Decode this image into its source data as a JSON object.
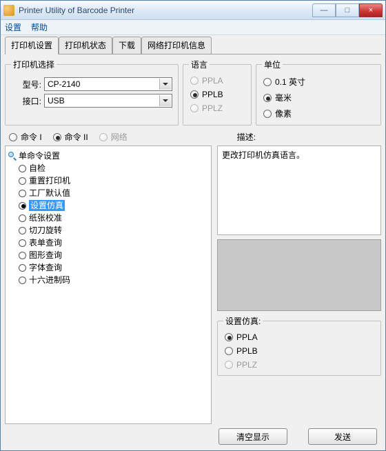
{
  "window": {
    "title": "Printer Utility of Barcode Printer"
  },
  "winbuttons": {
    "min": "—",
    "max": "□",
    "close": "×"
  },
  "menu": {
    "settings": "设置",
    "help": "帮助"
  },
  "tabs": [
    {
      "label": "打印机设置",
      "active": true
    },
    {
      "label": "打印机状态",
      "active": false
    },
    {
      "label": "下载",
      "active": false
    },
    {
      "label": "网络打印机信息",
      "active": false
    }
  ],
  "printer_select": {
    "legend": "打印机选择",
    "model_label": "型号:",
    "model_value": "CP-2140",
    "port_label": "接口:",
    "port_value": "USB"
  },
  "language": {
    "legend": "语言",
    "options": [
      {
        "label": "PPLA",
        "checked": false,
        "disabled": true
      },
      {
        "label": "PPLB",
        "checked": true,
        "disabled": false
      },
      {
        "label": "PPLZ",
        "checked": false,
        "disabled": true
      }
    ]
  },
  "unit": {
    "legend": "单位",
    "options": [
      {
        "label": "0.1 英寸",
        "checked": false
      },
      {
        "label": "毫米",
        "checked": true
      },
      {
        "label": "像素",
        "checked": false
      }
    ]
  },
  "cmd_modes": [
    {
      "label": "命令 I",
      "checked": false,
      "disabled": false
    },
    {
      "label": "命令 II",
      "checked": true,
      "disabled": false
    },
    {
      "label": "网络",
      "checked": false,
      "disabled": true
    }
  ],
  "desc_label": "描述:",
  "tree": {
    "root": "单命令设置",
    "items": [
      {
        "label": "自检",
        "selected": false
      },
      {
        "label": "重置打印机",
        "selected": false
      },
      {
        "label": "工厂默认值",
        "selected": false
      },
      {
        "label": "设置仿真",
        "selected": true
      },
      {
        "label": "纸张校准",
        "selected": false
      },
      {
        "label": "切刀旋转",
        "selected": false
      },
      {
        "label": "表单查询",
        "selected": false
      },
      {
        "label": "图形查询",
        "selected": false
      },
      {
        "label": "字体查询",
        "selected": false
      },
      {
        "label": "十六进制码",
        "selected": false
      }
    ]
  },
  "description_text": "更改打印机仿真语言。",
  "simulation": {
    "legend": "设置仿真:",
    "options": [
      {
        "label": "PPLA",
        "checked": true,
        "disabled": false
      },
      {
        "label": "PPLB",
        "checked": false,
        "disabled": false
      },
      {
        "label": "PPLZ",
        "checked": false,
        "disabled": true
      }
    ]
  },
  "buttons": {
    "clear": "清空显示",
    "send": "发送"
  }
}
